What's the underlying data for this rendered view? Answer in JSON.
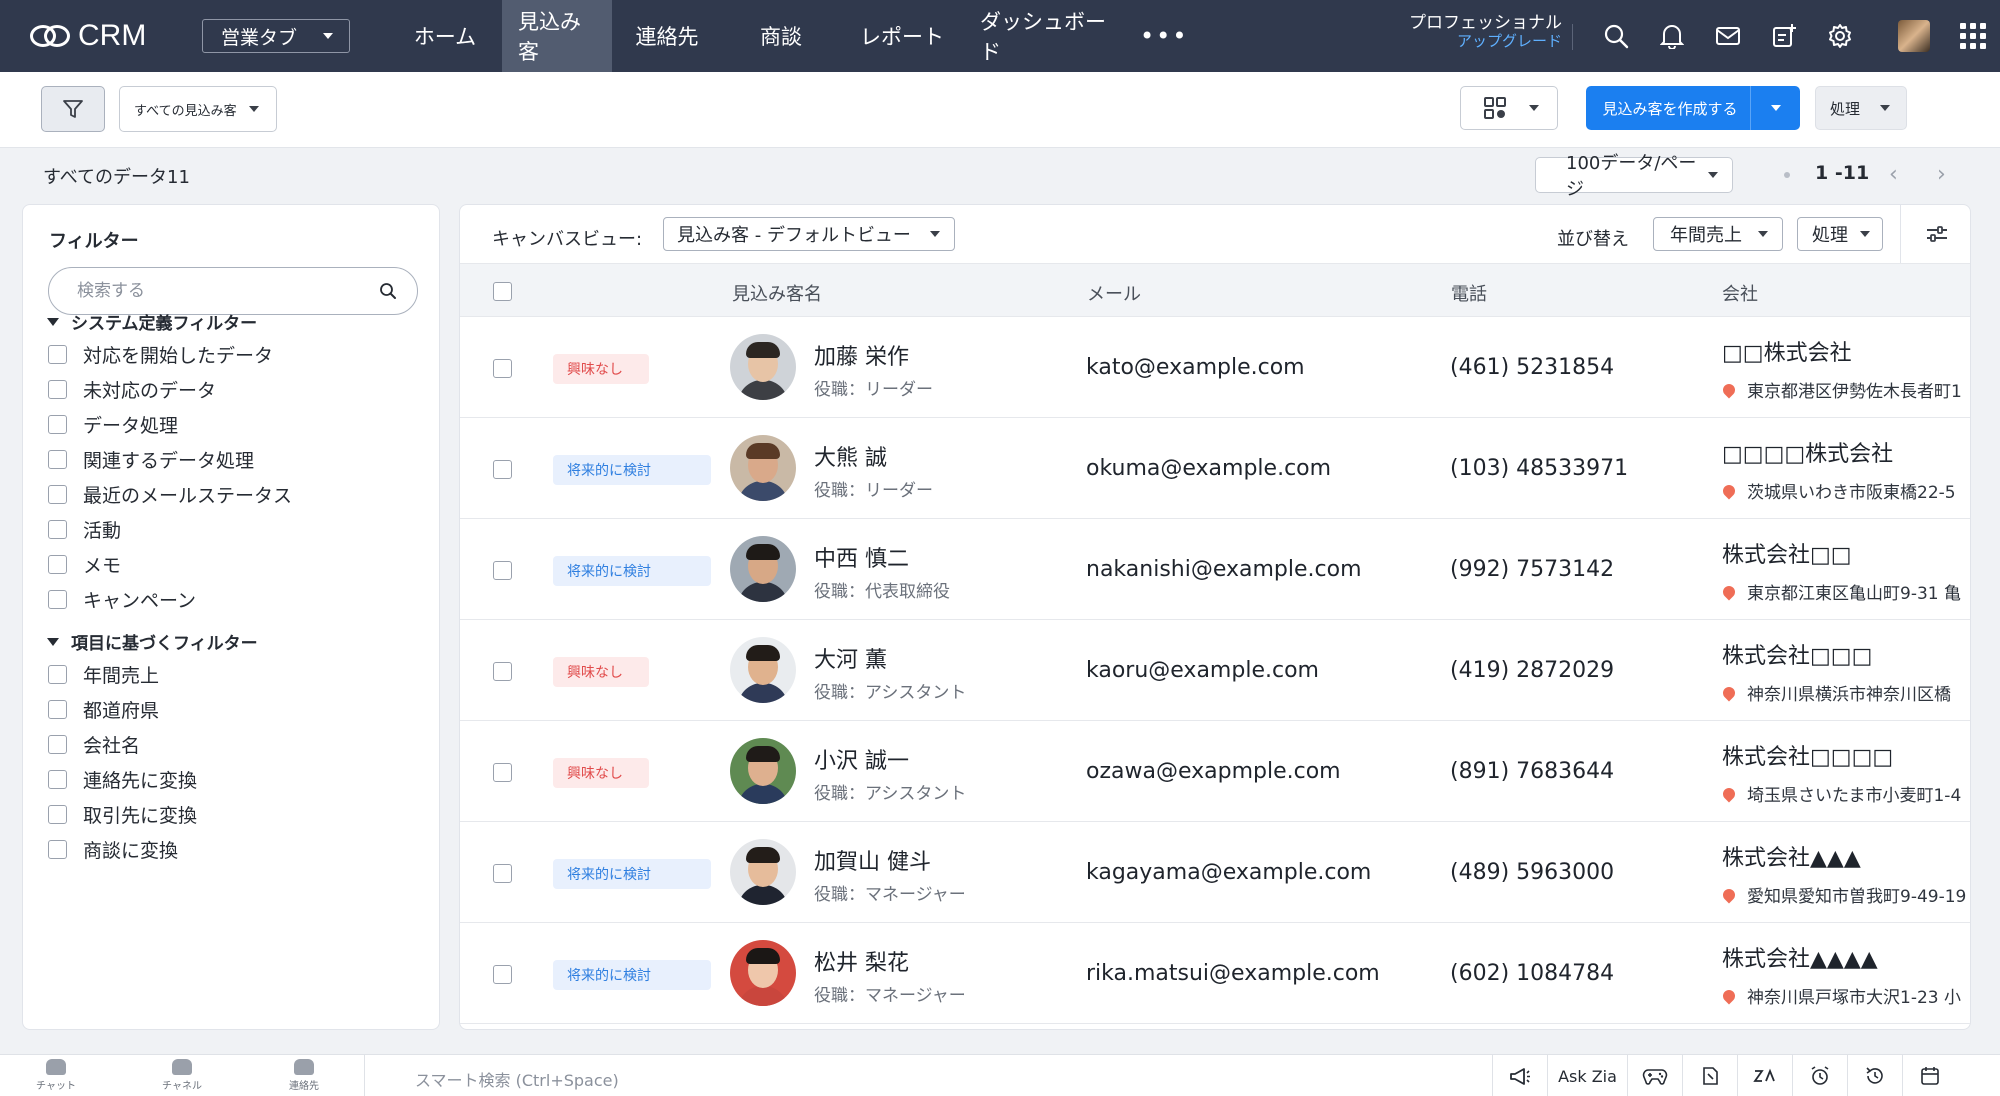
{
  "app": {
    "name": "CRM",
    "tab_select": "営業タブ"
  },
  "nav": {
    "items": [
      {
        "label": "ホーム",
        "active": false
      },
      {
        "label": "見込み客",
        "active": true
      },
      {
        "label": "連絡先",
        "active": false
      },
      {
        "label": "商談",
        "active": false
      },
      {
        "label": "レポート",
        "active": false
      },
      {
        "label": "ダッシュボード",
        "active": false
      }
    ],
    "more": "•••",
    "edition": "プロフェッショナル",
    "upgrade": "アップグレード",
    "icons": [
      "search-icon",
      "bell-icon",
      "mail-icon",
      "add-note-icon",
      "gear-icon",
      "user-avatar",
      "apps-grid-icon"
    ]
  },
  "toolbar": {
    "view_select": "すべての見込み客",
    "create_button": "見込み客を作成する",
    "action_button": "処理"
  },
  "summary": {
    "total": "すべてのデータ11",
    "per_page": "100データ/ページ",
    "range": "1 -11",
    "prev": "‹",
    "next": "›"
  },
  "sidebar": {
    "title": "フィルター",
    "search_placeholder": "検索する",
    "groups": [
      {
        "label": "システム定義フィルター",
        "items": [
          "対応を開始したデータ",
          "未対応のデータ",
          "データ処理",
          "関連するデータ処理",
          "最近のメールステータス",
          "活動",
          "メモ",
          "キャンペーン"
        ]
      },
      {
        "label": "項目に基づくフィルター",
        "items": [
          "年間売上",
          "都道府県",
          "会社名",
          "連絡先に変換",
          "取引先に変換",
          "商談に変換"
        ]
      }
    ]
  },
  "main": {
    "canvas_label": "キャンバスビュー:",
    "canvas_view": "見込み客 - デフォルトビュー",
    "sort_label": "並び替え",
    "sort_value": "年間売上",
    "process": "処理",
    "columns": [
      "見込み客名",
      "メール",
      "電話",
      "会社"
    ],
    "rows": [
      {
        "status": "興味なし",
        "status_type": "no",
        "name": "加藤 栄作",
        "role": "役職：リーダー",
        "email": "kato@example.com",
        "phone": "(461)  5231854",
        "company": "□□株式会社",
        "address": "東京都港区伊勢佐木長者町1",
        "skin": "#e7c4a6",
        "hair": "#2b2622",
        "shirt": "#3d3f44",
        "bg": "#cfd3d8"
      },
      {
        "status": "将来的に検討",
        "status_type": "future",
        "name": "大熊 誠",
        "role": "役職：リーダー",
        "email": "okuma@example.com",
        "phone": "(103)  48533971",
        "company": "□□□□株式会社",
        "address": "茨城県いわき市阪東橋22-5",
        "skin": "#d9a98a",
        "hair": "#5a3a26",
        "shirt": "#3b4a6a",
        "bg": "#c9b9a6"
      },
      {
        "status": "将来的に検討",
        "status_type": "future",
        "name": "中西 慎二",
        "role": "役職：代表取締役",
        "email": "nakanishi@example.com",
        "phone": "(992)  7573142",
        "company": "株式会社□□",
        "address": "東京都江東区亀山町9-31 亀",
        "skin": "#d7a886",
        "hair": "#1e1a17",
        "shirt": "#2d3340",
        "bg": "#9fa9b3"
      },
      {
        "status": "興味なし",
        "status_type": "no",
        "name": "大河 薫",
        "role": "役職：アシスタント",
        "email": "kaoru@example.com",
        "phone": "(419)  2872029",
        "company": "株式会社□□□",
        "address": "神奈川県横浜市神奈川区橋",
        "skin": "#e0b28e",
        "hair": "#221c18",
        "shirt": "#2f3a57",
        "bg": "#e9ecef"
      },
      {
        "status": "興味なし",
        "status_type": "no",
        "name": "小沢 誠一",
        "role": "役職：アシスタント",
        "email": "ozawa@exapmple.com",
        "phone": "(891)  7683644",
        "company": "株式会社□□□□",
        "address": "埼玉県さいたま市小麦町1-4",
        "skin": "#deb08f",
        "hair": "#1f1b18",
        "shirt": "#2a3b5c",
        "bg": "#5f8a52"
      },
      {
        "status": "将来的に検討",
        "status_type": "future",
        "name": "加賀山 健斗",
        "role": "役職：マネージャー",
        "email": "kagayama@example.com",
        "phone": "(489)  5963000",
        "company": "株式会社▲▲▲",
        "address": "愛知県愛知市曽我町9-49-19",
        "skin": "#e6bc9b",
        "hair": "#231d19",
        "shirt": "#1f2430",
        "bg": "#e4e6e9"
      },
      {
        "status": "将来的に検討",
        "status_type": "future",
        "name": "松井 梨花",
        "role": "役職：マネージャー",
        "email": "rika.matsui@example.com",
        "phone": "(602)  1084784",
        "company": "株式会社▲▲▲▲",
        "address": "神奈川県戸塚市大沢1-23 小",
        "skin": "#efc7ab",
        "hair": "#1b1715",
        "shirt": "#c9463d",
        "bg": "#d44a3f"
      }
    ]
  },
  "bottombar": {
    "chat": "チャット",
    "channel": "チャネル",
    "contacts": "連絡先",
    "smart_search": "スマート検索 (Ctrl+Space)",
    "ask_zia": "Ask Zia"
  },
  "colors": {
    "nav_bg": "#30394d",
    "nav_active": "#525c70",
    "primary": "#1b7ff0",
    "tag_no_bg": "#fdeaea",
    "tag_no_fg": "#e14c4c",
    "tag_future_bg": "#e8f0fd",
    "tag_future_fg": "#2f7fe0",
    "pin": "#ef6d56"
  }
}
